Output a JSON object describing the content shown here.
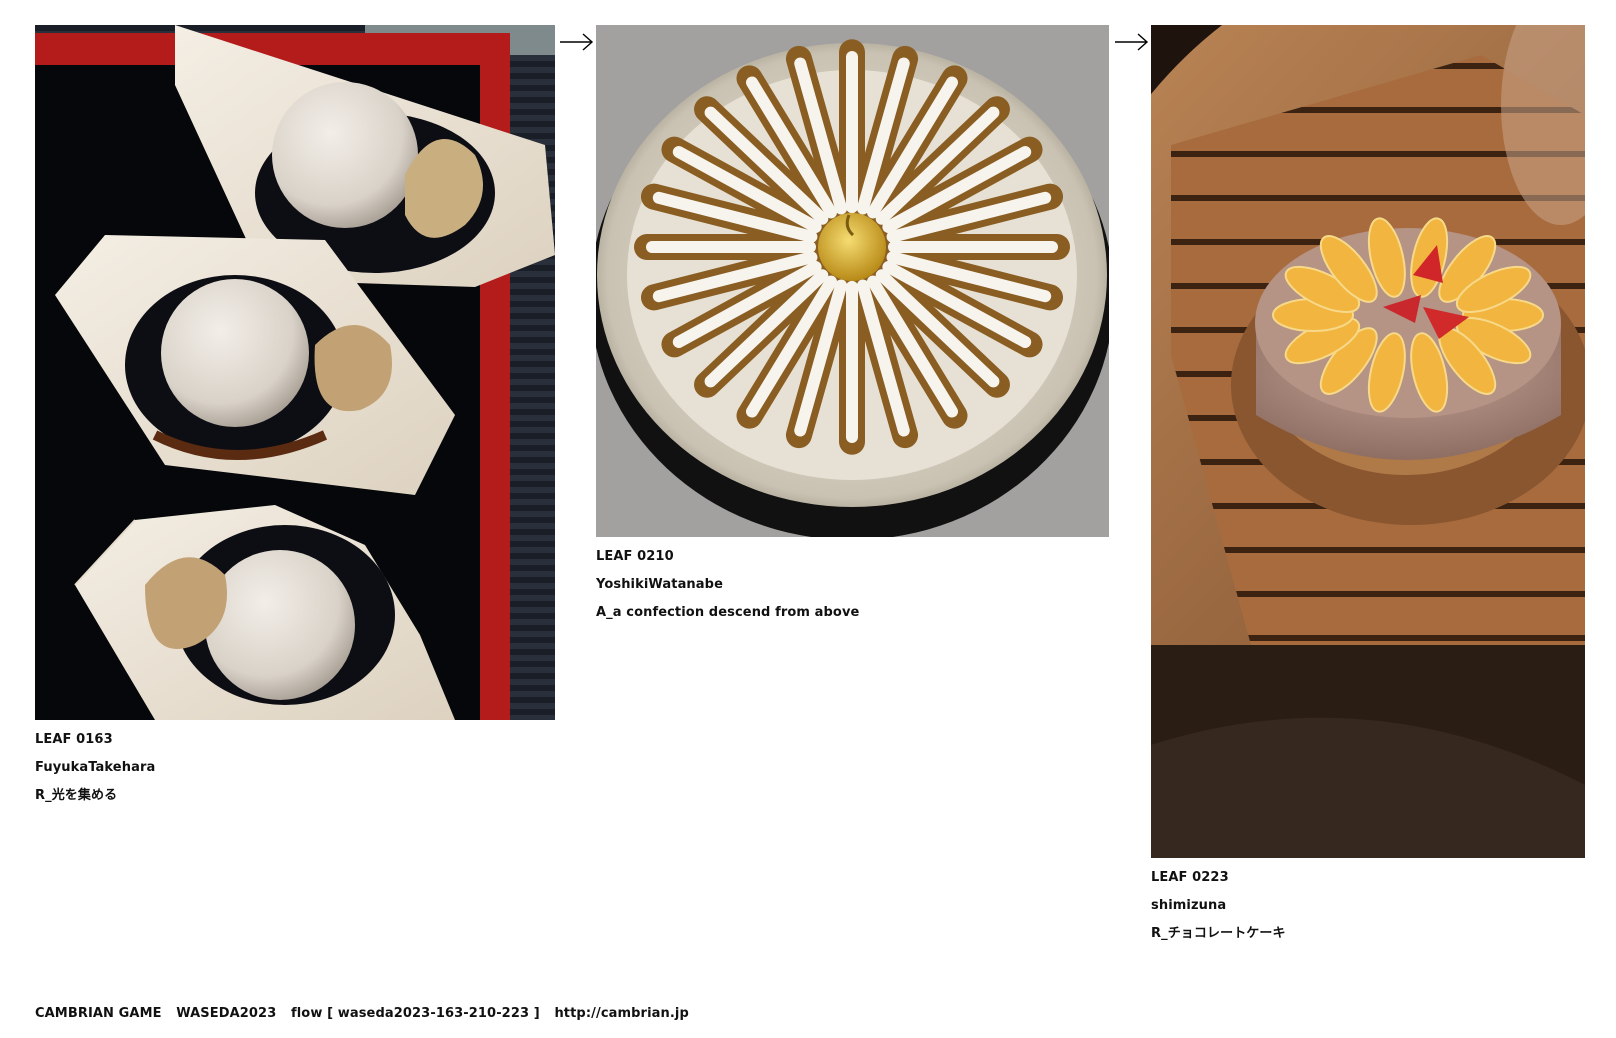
{
  "flow": [
    {
      "leaf_id": "LEAF 0163",
      "author": "FuyukaTakehara",
      "title": "R_光を集める",
      "image": "three mizu-shingen-mochi desserts on wooden boat dishes with kinako and kuromitsu on a black lacquer tray"
    },
    {
      "leaf_id": "LEAF 0210",
      "author": "YoshikiWatanabe",
      "title": "A_a confection descend from above",
      "image": "radial pastry with powdered sugar stripes and a golden center on a silver platter"
    },
    {
      "leaf_id": "LEAF 0223",
      "author": "shimizuna",
      "title": "R_チョコレートケーキ",
      "image": "chocolate cream cake topped with orange slices and strawberries on a round wooden table"
    }
  ],
  "arrows": [
    "→",
    "→"
  ],
  "footer": {
    "game": "CAMBRIAN GAME",
    "event": "WASEDA2023",
    "flow_label": "flow [ waseda2023-163-210-223 ]",
    "url": "http://cambrian.jp"
  }
}
